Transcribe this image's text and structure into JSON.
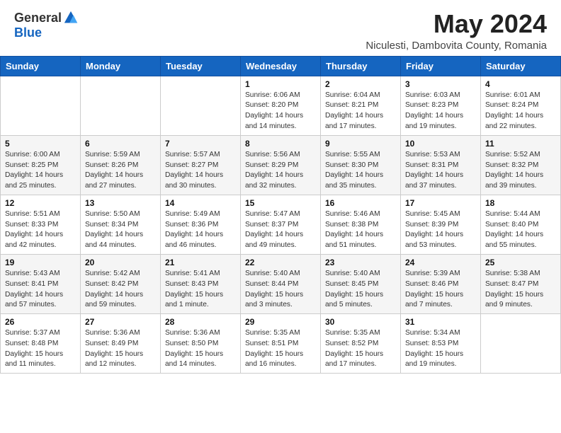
{
  "header": {
    "logo_general": "General",
    "logo_blue": "Blue",
    "month_year": "May 2024",
    "location": "Niculesti, Dambovita County, Romania"
  },
  "days_of_week": [
    "Sunday",
    "Monday",
    "Tuesday",
    "Wednesday",
    "Thursday",
    "Friday",
    "Saturday"
  ],
  "weeks": [
    [
      {
        "day": "",
        "info": ""
      },
      {
        "day": "",
        "info": ""
      },
      {
        "day": "",
        "info": ""
      },
      {
        "day": "1",
        "info": "Sunrise: 6:06 AM\nSunset: 8:20 PM\nDaylight: 14 hours and 14 minutes."
      },
      {
        "day": "2",
        "info": "Sunrise: 6:04 AM\nSunset: 8:21 PM\nDaylight: 14 hours and 17 minutes."
      },
      {
        "day": "3",
        "info": "Sunrise: 6:03 AM\nSunset: 8:23 PM\nDaylight: 14 hours and 19 minutes."
      },
      {
        "day": "4",
        "info": "Sunrise: 6:01 AM\nSunset: 8:24 PM\nDaylight: 14 hours and 22 minutes."
      }
    ],
    [
      {
        "day": "5",
        "info": "Sunrise: 6:00 AM\nSunset: 8:25 PM\nDaylight: 14 hours and 25 minutes."
      },
      {
        "day": "6",
        "info": "Sunrise: 5:59 AM\nSunset: 8:26 PM\nDaylight: 14 hours and 27 minutes."
      },
      {
        "day": "7",
        "info": "Sunrise: 5:57 AM\nSunset: 8:27 PM\nDaylight: 14 hours and 30 minutes."
      },
      {
        "day": "8",
        "info": "Sunrise: 5:56 AM\nSunset: 8:29 PM\nDaylight: 14 hours and 32 minutes."
      },
      {
        "day": "9",
        "info": "Sunrise: 5:55 AM\nSunset: 8:30 PM\nDaylight: 14 hours and 35 minutes."
      },
      {
        "day": "10",
        "info": "Sunrise: 5:53 AM\nSunset: 8:31 PM\nDaylight: 14 hours and 37 minutes."
      },
      {
        "day": "11",
        "info": "Sunrise: 5:52 AM\nSunset: 8:32 PM\nDaylight: 14 hours and 39 minutes."
      }
    ],
    [
      {
        "day": "12",
        "info": "Sunrise: 5:51 AM\nSunset: 8:33 PM\nDaylight: 14 hours and 42 minutes."
      },
      {
        "day": "13",
        "info": "Sunrise: 5:50 AM\nSunset: 8:34 PM\nDaylight: 14 hours and 44 minutes."
      },
      {
        "day": "14",
        "info": "Sunrise: 5:49 AM\nSunset: 8:36 PM\nDaylight: 14 hours and 46 minutes."
      },
      {
        "day": "15",
        "info": "Sunrise: 5:47 AM\nSunset: 8:37 PM\nDaylight: 14 hours and 49 minutes."
      },
      {
        "day": "16",
        "info": "Sunrise: 5:46 AM\nSunset: 8:38 PM\nDaylight: 14 hours and 51 minutes."
      },
      {
        "day": "17",
        "info": "Sunrise: 5:45 AM\nSunset: 8:39 PM\nDaylight: 14 hours and 53 minutes."
      },
      {
        "day": "18",
        "info": "Sunrise: 5:44 AM\nSunset: 8:40 PM\nDaylight: 14 hours and 55 minutes."
      }
    ],
    [
      {
        "day": "19",
        "info": "Sunrise: 5:43 AM\nSunset: 8:41 PM\nDaylight: 14 hours and 57 minutes."
      },
      {
        "day": "20",
        "info": "Sunrise: 5:42 AM\nSunset: 8:42 PM\nDaylight: 14 hours and 59 minutes."
      },
      {
        "day": "21",
        "info": "Sunrise: 5:41 AM\nSunset: 8:43 PM\nDaylight: 15 hours and 1 minute."
      },
      {
        "day": "22",
        "info": "Sunrise: 5:40 AM\nSunset: 8:44 PM\nDaylight: 15 hours and 3 minutes."
      },
      {
        "day": "23",
        "info": "Sunrise: 5:40 AM\nSunset: 8:45 PM\nDaylight: 15 hours and 5 minutes."
      },
      {
        "day": "24",
        "info": "Sunrise: 5:39 AM\nSunset: 8:46 PM\nDaylight: 15 hours and 7 minutes."
      },
      {
        "day": "25",
        "info": "Sunrise: 5:38 AM\nSunset: 8:47 PM\nDaylight: 15 hours and 9 minutes."
      }
    ],
    [
      {
        "day": "26",
        "info": "Sunrise: 5:37 AM\nSunset: 8:48 PM\nDaylight: 15 hours and 11 minutes."
      },
      {
        "day": "27",
        "info": "Sunrise: 5:36 AM\nSunset: 8:49 PM\nDaylight: 15 hours and 12 minutes."
      },
      {
        "day": "28",
        "info": "Sunrise: 5:36 AM\nSunset: 8:50 PM\nDaylight: 15 hours and 14 minutes."
      },
      {
        "day": "29",
        "info": "Sunrise: 5:35 AM\nSunset: 8:51 PM\nDaylight: 15 hours and 16 minutes."
      },
      {
        "day": "30",
        "info": "Sunrise: 5:35 AM\nSunset: 8:52 PM\nDaylight: 15 hours and 17 minutes."
      },
      {
        "day": "31",
        "info": "Sunrise: 5:34 AM\nSunset: 8:53 PM\nDaylight: 15 hours and 19 minutes."
      },
      {
        "day": "",
        "info": ""
      }
    ]
  ]
}
